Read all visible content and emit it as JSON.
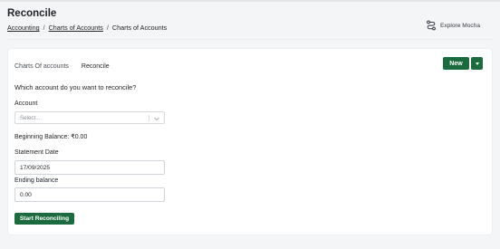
{
  "header": {
    "title": "Reconcile",
    "breadcrumb": [
      "Accounting",
      "Charts of Accounts",
      "Charts of Accounts"
    ],
    "breadcrumb_sep": "/",
    "explore_label": "Explore Mocha"
  },
  "tabs": [
    {
      "label": "Charts Of accounts",
      "active": false
    },
    {
      "label": "Reconcile",
      "active": true
    }
  ],
  "actions": {
    "new_label": "New"
  },
  "form": {
    "question": "Which account do you want to reconcile?",
    "account_label": "Account",
    "account_placeholder": "Select...",
    "beginning_balance": "Beginning Balance: ₹0.00",
    "statement_date_label": "Statement Date",
    "statement_date_value": "17/09/2025",
    "ending_balance_label": "Ending balance",
    "ending_balance_value": "0.00",
    "start_button": "Start Reconciling"
  },
  "colors": {
    "primary": "#1b6b3f",
    "background": "#f4f5f7",
    "card": "#ffffff"
  },
  "icons": {
    "explore": "route-icon",
    "dropdown": "chevron-down-icon",
    "caret": "caret-down-icon"
  }
}
